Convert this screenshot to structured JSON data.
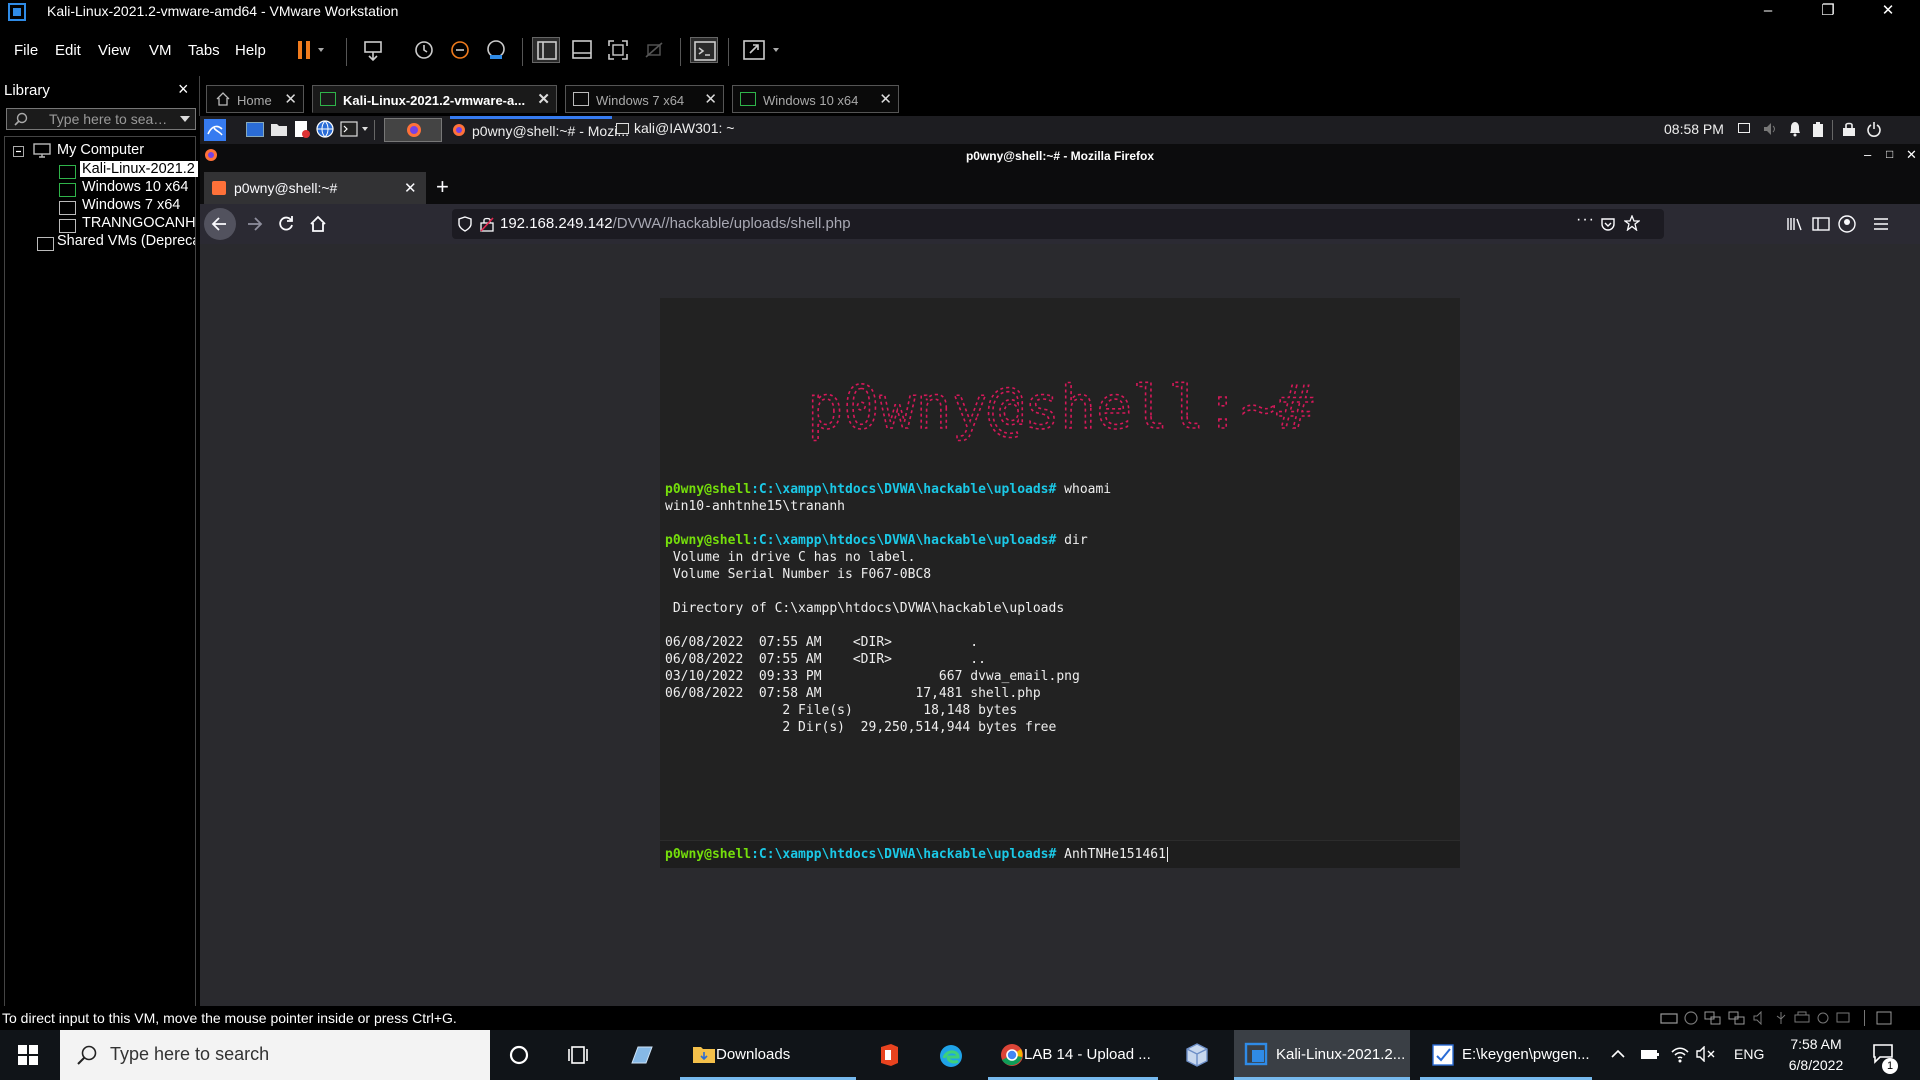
{
  "window": {
    "title": "Kali-Linux-2021.2-vmware-amd64 - VMware Workstation",
    "minimize": "–",
    "restore": "❐",
    "close": "✕"
  },
  "menu": [
    "File",
    "Edit",
    "View",
    "VM",
    "Tabs",
    "Help"
  ],
  "library": {
    "title": "Library",
    "close": "×",
    "search_placeholder": "Type here to sea…",
    "tree": {
      "root": "My Computer",
      "vms": [
        "Kali-Linux-2021.2",
        "Windows 10 x64",
        "Windows 7 x64",
        "TRANNGOCANH-"
      ],
      "shared": "Shared VMs (Deprecated)"
    }
  },
  "vm_tabs": [
    {
      "label": "Home"
    },
    {
      "label": "Kali-Linux-2021.2-vmware-a..."
    },
    {
      "label": "Windows 7 x64"
    },
    {
      "label": "Windows 10 x64"
    }
  ],
  "kali_panel": {
    "tasks": [
      "p0wny@shell:~# - Mozi...",
      "kali@IAW301: ~"
    ],
    "clock": "08:58 PM"
  },
  "firefox": {
    "window_title": "p0wny@shell:~# - Mozilla Firefox",
    "tab_title": "p0wny@shell:~#",
    "url_host": "192.168.249.142",
    "url_path": "/DVWA//hackable/uploads/shell.php"
  },
  "shell": {
    "ascii_art": "p0wny@shell:~#",
    "user": "p0wny@shell",
    "path": ":C:\\xampp\\htdocs\\DVWA\\hackable\\uploads#",
    "cmd1": "whoami",
    "out1": "win10-anhtnhe15\\trananh",
    "cmd2": "dir",
    "out2": [
      " Volume in drive C has no label.",
      " Volume Serial Number is F067-0BC8",
      "",
      " Directory of C:\\xampp\\htdocs\\DVWA\\hackable\\uploads",
      "",
      "06/08/2022  07:55 AM    <DIR>          .",
      "06/08/2022  07:55 AM    <DIR>          ..",
      "03/10/2022  09:33 PM               667 dvwa_email.png",
      "06/08/2022  07:58 AM            17,481 shell.php",
      "               2 File(s)         18,148 bytes",
      "               2 Dir(s)  29,250,514,944 bytes free"
    ],
    "input_value": "AnhTNHe151461"
  },
  "status_bar": {
    "message": "To direct input to this VM, move the mouse pointer inside or press Ctrl+G."
  },
  "taskbar": {
    "search_placeholder": "Type here to search",
    "apps": [
      {
        "label": "Downloads"
      },
      {
        "label": "LAB 14 - Upload ..."
      },
      {
        "label": "Kali-Linux-2021.2..."
      },
      {
        "label": "E:\\keygen\\pwgen..."
      }
    ],
    "lang": "ENG",
    "time": "7:58 AM",
    "date": "6/8/2022",
    "notif_count": "1"
  },
  "colors": {
    "accent": "#0078d4",
    "prompt_user": "#75df0b",
    "prompt_path": "#1bc9e7",
    "ascii_art": "#d6195a"
  }
}
